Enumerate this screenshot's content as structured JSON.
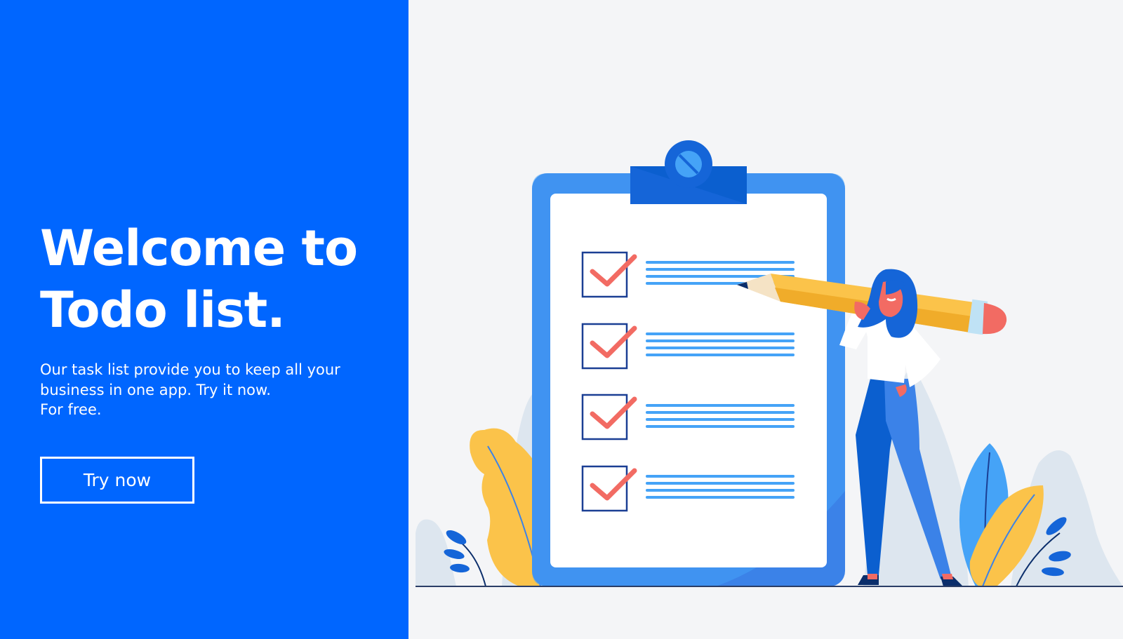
{
  "hero": {
    "title_line1": "Welcome to",
    "title_line2": "Todo list.",
    "description_line1": "Our task list provide you to keep all your",
    "description_line2": "business in one app. Try it now.",
    "description_line3": "For free.",
    "cta_label": "Try now"
  },
  "illustration": {
    "checklist_items": 4,
    "all_checked": true
  },
  "colors": {
    "brand_blue": "#0066ff",
    "background": "#f4f5f7",
    "check_red": "#f26b63",
    "pencil_yellow": "#fbc34a"
  }
}
